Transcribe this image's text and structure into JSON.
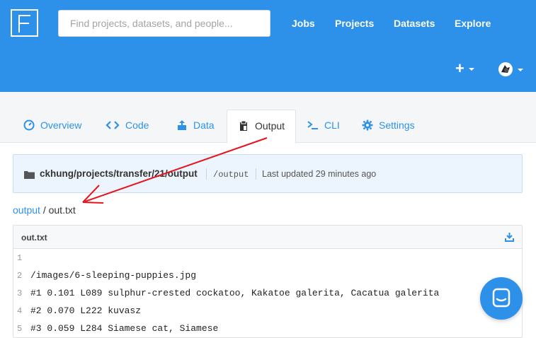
{
  "search": {
    "placeholder": "Find projects, datasets, and people..."
  },
  "nav": {
    "jobs": "Jobs",
    "projects": "Projects",
    "datasets": "Datasets",
    "explore": "Explore"
  },
  "header_actions": {
    "plus": "+"
  },
  "tabs": [
    {
      "label": "Overview",
      "icon": "dashboard-icon"
    },
    {
      "label": "Code",
      "icon": "code-icon"
    },
    {
      "label": "Data",
      "icon": "upload-icon"
    },
    {
      "label": "Output",
      "icon": "clipboard-icon",
      "active": true
    },
    {
      "label": "CLI",
      "icon": "terminal-icon"
    },
    {
      "label": "Settings",
      "icon": "gear-icon"
    }
  ],
  "pathbox": {
    "path": "ckhung/projects/transfer/21/output",
    "mount": "/output",
    "updated": "Last updated 29 minutes ago"
  },
  "breadcrumb": {
    "folder": "output",
    "separator": "/",
    "file": "out.txt"
  },
  "file": {
    "name": "out.txt",
    "lines": [
      {
        "n": "1",
        "text": ""
      },
      {
        "n": "2",
        "text": "/images/6-sleeping-puppies.jpg"
      },
      {
        "n": "3",
        "text": "#1 0.101 L089 sulphur-crested cockatoo, Kakatoe galerita, Cacatua galerita"
      },
      {
        "n": "4",
        "text": "#2 0.070 L222 kuvasz"
      },
      {
        "n": "5",
        "text": "#3 0.059 L284 Siamese cat, Siamese"
      }
    ]
  },
  "colors": {
    "brand": "#2d91ea",
    "annotation": "#e8141c"
  }
}
